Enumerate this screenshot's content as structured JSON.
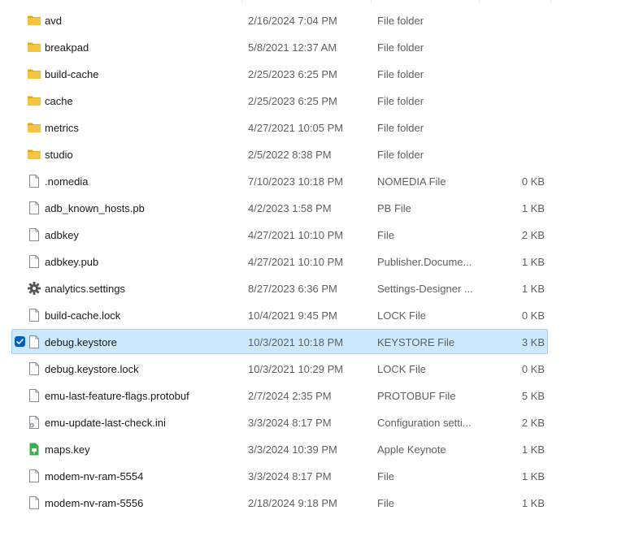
{
  "files": [
    {
      "name": "avd",
      "date": "2/16/2024 7:04 PM",
      "type": "File folder",
      "size": "",
      "icon": "folder-icon",
      "selected": false
    },
    {
      "name": "breakpad",
      "date": "5/8/2021 12:37 AM",
      "type": "File folder",
      "size": "",
      "icon": "folder-icon",
      "selected": false
    },
    {
      "name": "build-cache",
      "date": "2/25/2023 6:25 PM",
      "type": "File folder",
      "size": "",
      "icon": "folder-icon",
      "selected": false
    },
    {
      "name": "cache",
      "date": "2/25/2023 6:25 PM",
      "type": "File folder",
      "size": "",
      "icon": "folder-icon",
      "selected": false
    },
    {
      "name": "metrics",
      "date": "4/27/2021 10:05 PM",
      "type": "File folder",
      "size": "",
      "icon": "folder-icon",
      "selected": false
    },
    {
      "name": "studio",
      "date": "2/5/2022 8:38 PM",
      "type": "File folder",
      "size": "",
      "icon": "folder-icon",
      "selected": false
    },
    {
      "name": ".nomedia",
      "date": "7/10/2023 10:18 PM",
      "type": "NOMEDIA File",
      "size": "0 KB",
      "icon": "file-icon",
      "selected": false
    },
    {
      "name": "adb_known_hosts.pb",
      "date": "4/2/2023 1:58 PM",
      "type": "PB File",
      "size": "1 KB",
      "icon": "file-icon",
      "selected": false
    },
    {
      "name": "adbkey",
      "date": "4/27/2021 10:10 PM",
      "type": "File",
      "size": "2 KB",
      "icon": "file-icon",
      "selected": false
    },
    {
      "name": "adbkey.pub",
      "date": "4/27/2021 10:10 PM",
      "type": "Publisher.Docume...",
      "size": "1 KB",
      "icon": "file-icon",
      "selected": false
    },
    {
      "name": "analytics.settings",
      "date": "8/27/2023 6:36 PM",
      "type": "Settings-Designer ...",
      "size": "1 KB",
      "icon": "gear-icon",
      "selected": false
    },
    {
      "name": "build-cache.lock",
      "date": "10/4/2021 9:45 PM",
      "type": "LOCK File",
      "size": "0 KB",
      "icon": "file-icon",
      "selected": false
    },
    {
      "name": "debug.keystore",
      "date": "10/3/2021 10:18 PM",
      "type": "KEYSTORE File",
      "size": "3 KB",
      "icon": "file-icon",
      "selected": true
    },
    {
      "name": "debug.keystore.lock",
      "date": "10/3/2021 10:29 PM",
      "type": "LOCK File",
      "size": "0 KB",
      "icon": "file-icon",
      "selected": false
    },
    {
      "name": "emu-last-feature-flags.protobuf",
      "date": "2/7/2024 2:35 PM",
      "type": "PROTOBUF File",
      "size": "5 KB",
      "icon": "file-icon",
      "selected": false
    },
    {
      "name": "emu-update-last-check.ini",
      "date": "3/3/2024 8:17 PM",
      "type": "Configuration setti...",
      "size": "2 KB",
      "icon": "config-file-icon",
      "selected": false
    },
    {
      "name": "maps.key",
      "date": "3/3/2024 10:39 PM",
      "type": "Apple Keynote",
      "size": "1 KB",
      "icon": "keynote-icon",
      "selected": false
    },
    {
      "name": "modem-nv-ram-5554",
      "date": "3/3/2024 8:17 PM",
      "type": "File",
      "size": "1 KB",
      "icon": "file-icon",
      "selected": false
    },
    {
      "name": "modem-nv-ram-5556",
      "date": "2/18/2024 9:18 PM",
      "type": "File",
      "size": "1 KB",
      "icon": "file-icon",
      "selected": false
    }
  ],
  "colors": {
    "folder": "#f6c342",
    "folder_dark": "#e8a600",
    "selection_bg": "#cce8ff",
    "selection_border": "#99d1ff",
    "checkbox": "#005fb8",
    "keynote": "#35b34a"
  }
}
